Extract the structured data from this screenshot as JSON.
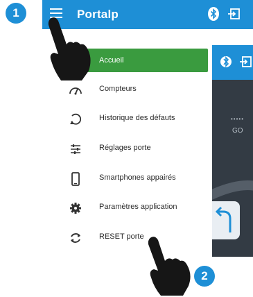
{
  "app": {
    "title": "Portalp"
  },
  "steps": {
    "one": "1",
    "two": "2"
  },
  "background_screen": {
    "indicator_dots": "•••••",
    "go_label": "GO"
  },
  "drawer": {
    "items": [
      {
        "label": "Accueil",
        "icon": "home-icon",
        "active": true
      },
      {
        "label": "Compteurs",
        "icon": "gauge-icon"
      },
      {
        "label": "Historique des défauts",
        "icon": "history-icon"
      },
      {
        "label": "Réglages porte",
        "icon": "sliders-icon"
      },
      {
        "label": "Smartphones appairés",
        "icon": "smartphone-icon"
      },
      {
        "label": "Paramètres application",
        "icon": "gear-icon"
      },
      {
        "label": "RESET porte",
        "icon": "refresh-icon"
      }
    ]
  },
  "colors": {
    "primary": "#1e8fd6",
    "active": "#3a9b3f",
    "dark": "#333b44"
  }
}
